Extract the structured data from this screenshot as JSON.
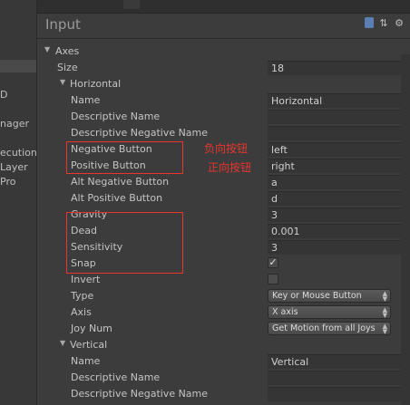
{
  "left_panel": {
    "fragments": [
      "D",
      "nager",
      "ecution",
      "Layer",
      "Pro"
    ]
  },
  "header": {
    "title": "Input"
  },
  "rows": [
    {
      "kind": "foldout",
      "label": "Axes",
      "indent": 0
    },
    {
      "kind": "text",
      "label": "Size",
      "indent": 1,
      "value": "18"
    },
    {
      "kind": "foldout",
      "label": "Horizontal",
      "indent": 1
    },
    {
      "kind": "text",
      "label": "Name",
      "indent": 2,
      "value": "Horizontal"
    },
    {
      "kind": "text",
      "label": "Descriptive Name",
      "indent": 2,
      "value": ""
    },
    {
      "kind": "text",
      "label": "Descriptive Negative Name",
      "indent": 2,
      "value": ""
    },
    {
      "kind": "text",
      "label": "Negative Button",
      "indent": 2,
      "value": "left"
    },
    {
      "kind": "text",
      "label": "Positive Button",
      "indent": 2,
      "value": "right"
    },
    {
      "kind": "text",
      "label": "Alt Negative Button",
      "indent": 2,
      "value": "a"
    },
    {
      "kind": "text",
      "label": "Alt Positive Button",
      "indent": 2,
      "value": "d"
    },
    {
      "kind": "text",
      "label": "Gravity",
      "indent": 2,
      "value": "3"
    },
    {
      "kind": "text",
      "label": "Dead",
      "indent": 2,
      "value": "0.001"
    },
    {
      "kind": "text",
      "label": "Sensitivity",
      "indent": 2,
      "value": "3"
    },
    {
      "kind": "toggle",
      "label": "Snap",
      "indent": 2,
      "checked": true
    },
    {
      "kind": "toggle",
      "label": "Invert",
      "indent": 2,
      "checked": false
    },
    {
      "kind": "dropdown",
      "label": "Type",
      "indent": 2,
      "value": "Key or Mouse Button"
    },
    {
      "kind": "dropdown",
      "label": "Axis",
      "indent": 2,
      "value": "X axis"
    },
    {
      "kind": "dropdown",
      "label": "Joy Num",
      "indent": 2,
      "value": "Get Motion from all Joys"
    },
    {
      "kind": "foldout",
      "label": "Vertical",
      "indent": 1
    },
    {
      "kind": "text",
      "label": "Name",
      "indent": 2,
      "value": "Vertical"
    },
    {
      "kind": "text",
      "label": "Descriptive Name",
      "indent": 2,
      "value": ""
    },
    {
      "kind": "text",
      "label": "Descriptive Negative Name",
      "indent": 2,
      "value": ""
    }
  ],
  "annotations": {
    "negative": "负向按钮",
    "positive": "正向按钮",
    "color": "#e8352e"
  }
}
